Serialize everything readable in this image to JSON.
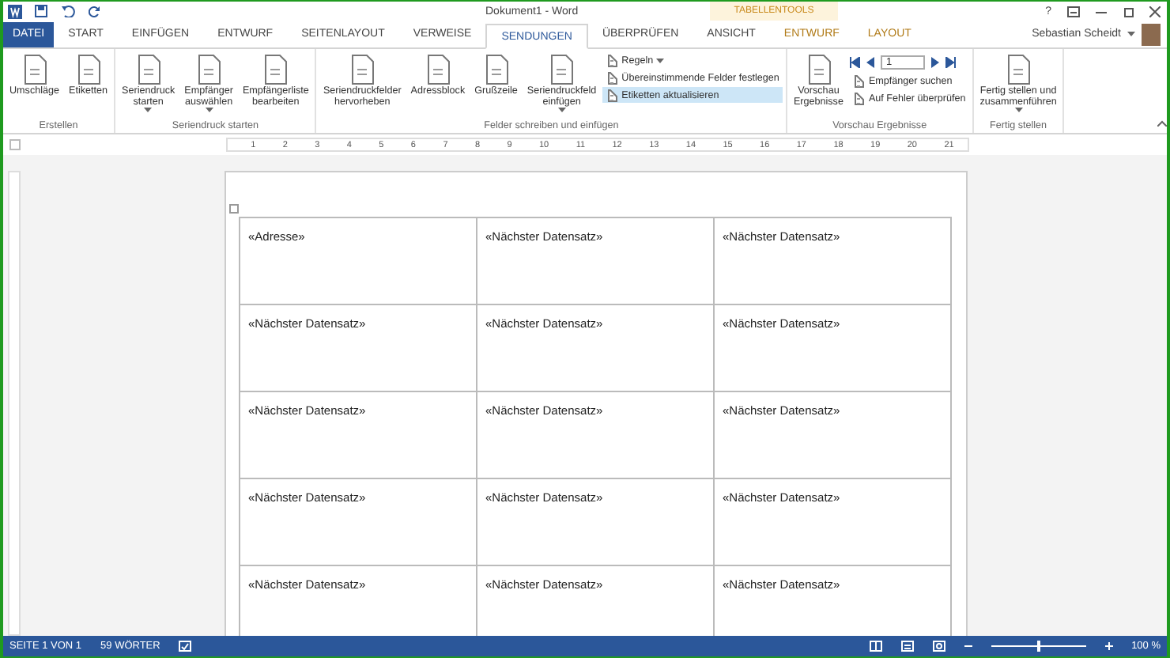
{
  "title_bar": {
    "title": "Dokument1 - Word",
    "help": "?",
    "contextual_label": "TABELLENTOOLS",
    "user": "Sebastian Scheidt"
  },
  "tabs": [
    {
      "label": "DATEI",
      "kind": "file",
      "selected": false
    },
    {
      "label": "START",
      "kind": "tab",
      "selected": false
    },
    {
      "label": "EINFÜGEN",
      "kind": "tab",
      "selected": false
    },
    {
      "label": "ENTWURF",
      "kind": "tab",
      "selected": false
    },
    {
      "label": "SEITENLAYOUT",
      "kind": "tab",
      "selected": false
    },
    {
      "label": "VERWEISE",
      "kind": "tab",
      "selected": false
    },
    {
      "label": "SENDUNGEN",
      "kind": "tab",
      "selected": true
    },
    {
      "label": "ÜBERPRÜFEN",
      "kind": "tab",
      "selected": false
    },
    {
      "label": "ANSICHT",
      "kind": "tab",
      "selected": false
    },
    {
      "label": "ENTWURF",
      "kind": "contextual",
      "selected": false
    },
    {
      "label": "LAYOUT",
      "kind": "contextual",
      "selected": false
    }
  ],
  "ribbon": {
    "groups": [
      {
        "label": "Erstellen",
        "items": [
          {
            "kind": "large",
            "label": "Umschläge",
            "dropdown": false
          },
          {
            "kind": "large",
            "label": "Etiketten",
            "dropdown": false
          }
        ]
      },
      {
        "label": "Seriendruck starten",
        "items": [
          {
            "kind": "large",
            "label": "Seriendruck\nstarten",
            "dropdown": true
          },
          {
            "kind": "large",
            "label": "Empfänger\nauswählen",
            "dropdown": true
          },
          {
            "kind": "large",
            "label": "Empfängerliste\nbearbeiten",
            "dropdown": false
          }
        ]
      },
      {
        "label": "Felder schreiben und einfügen",
        "items": [
          {
            "kind": "large",
            "label": "Seriendruckfelder\nhervorheben",
            "dropdown": false
          },
          {
            "kind": "large",
            "label": "Adressblock",
            "dropdown": false
          },
          {
            "kind": "large",
            "label": "Grußzeile",
            "dropdown": false
          },
          {
            "kind": "large",
            "label": "Seriendruckfeld\neinfügen",
            "dropdown": true
          },
          {
            "kind": "stack",
            "items": [
              {
                "label": "Regeln",
                "dropdown": true,
                "hovered": false
              },
              {
                "label": "Übereinstimmende Felder festlegen",
                "dropdown": false,
                "hovered": false
              },
              {
                "label": "Etiketten aktualisieren",
                "dropdown": false,
                "hovered": true
              }
            ]
          }
        ]
      },
      {
        "label": "Vorschau Ergebnisse",
        "items": [
          {
            "kind": "large",
            "label": "Vorschau\nErgebnisse",
            "dropdown": false
          },
          {
            "kind": "nav",
            "record": "1",
            "items": [
              {
                "label": "Empfänger suchen",
                "dropdown": false,
                "hovered": false
              },
              {
                "label": "Auf Fehler überprüfen",
                "dropdown": false,
                "hovered": false
              }
            ]
          }
        ]
      },
      {
        "label": "Fertig stellen",
        "items": [
          {
            "kind": "large",
            "label": "Fertig stellen und\nzusammenführen",
            "dropdown": true
          }
        ]
      }
    ]
  },
  "ruler": [
    "1",
    "2",
    "3",
    "4",
    "5",
    "6",
    "7",
    "8",
    "9",
    "10",
    "11",
    "12",
    "13",
    "14",
    "15",
    "16",
    "17",
    "18",
    "19",
    "20",
    "21"
  ],
  "table": {
    "rows": [
      [
        "«Adresse»",
        "«Nächster Datensatz»",
        "«Nächster Datensatz»"
      ],
      [
        "«Nächster Datensatz»",
        "«Nächster Datensatz»",
        "«Nächster Datensatz»"
      ],
      [
        "«Nächster Datensatz»",
        "«Nächster Datensatz»",
        "«Nächster Datensatz»"
      ],
      [
        "«Nächster Datensatz»",
        "«Nächster Datensatz»",
        "«Nächster Datensatz»"
      ],
      [
        "«Nächster Datensatz»",
        "«Nächster Datensatz»",
        "«Nächster Datensatz»"
      ]
    ]
  },
  "status_bar": {
    "page": "SEITE 1 VON 1",
    "words": "59 WÖRTER",
    "zoom": {
      "level": 0.5,
      "reading": "100 %"
    }
  }
}
